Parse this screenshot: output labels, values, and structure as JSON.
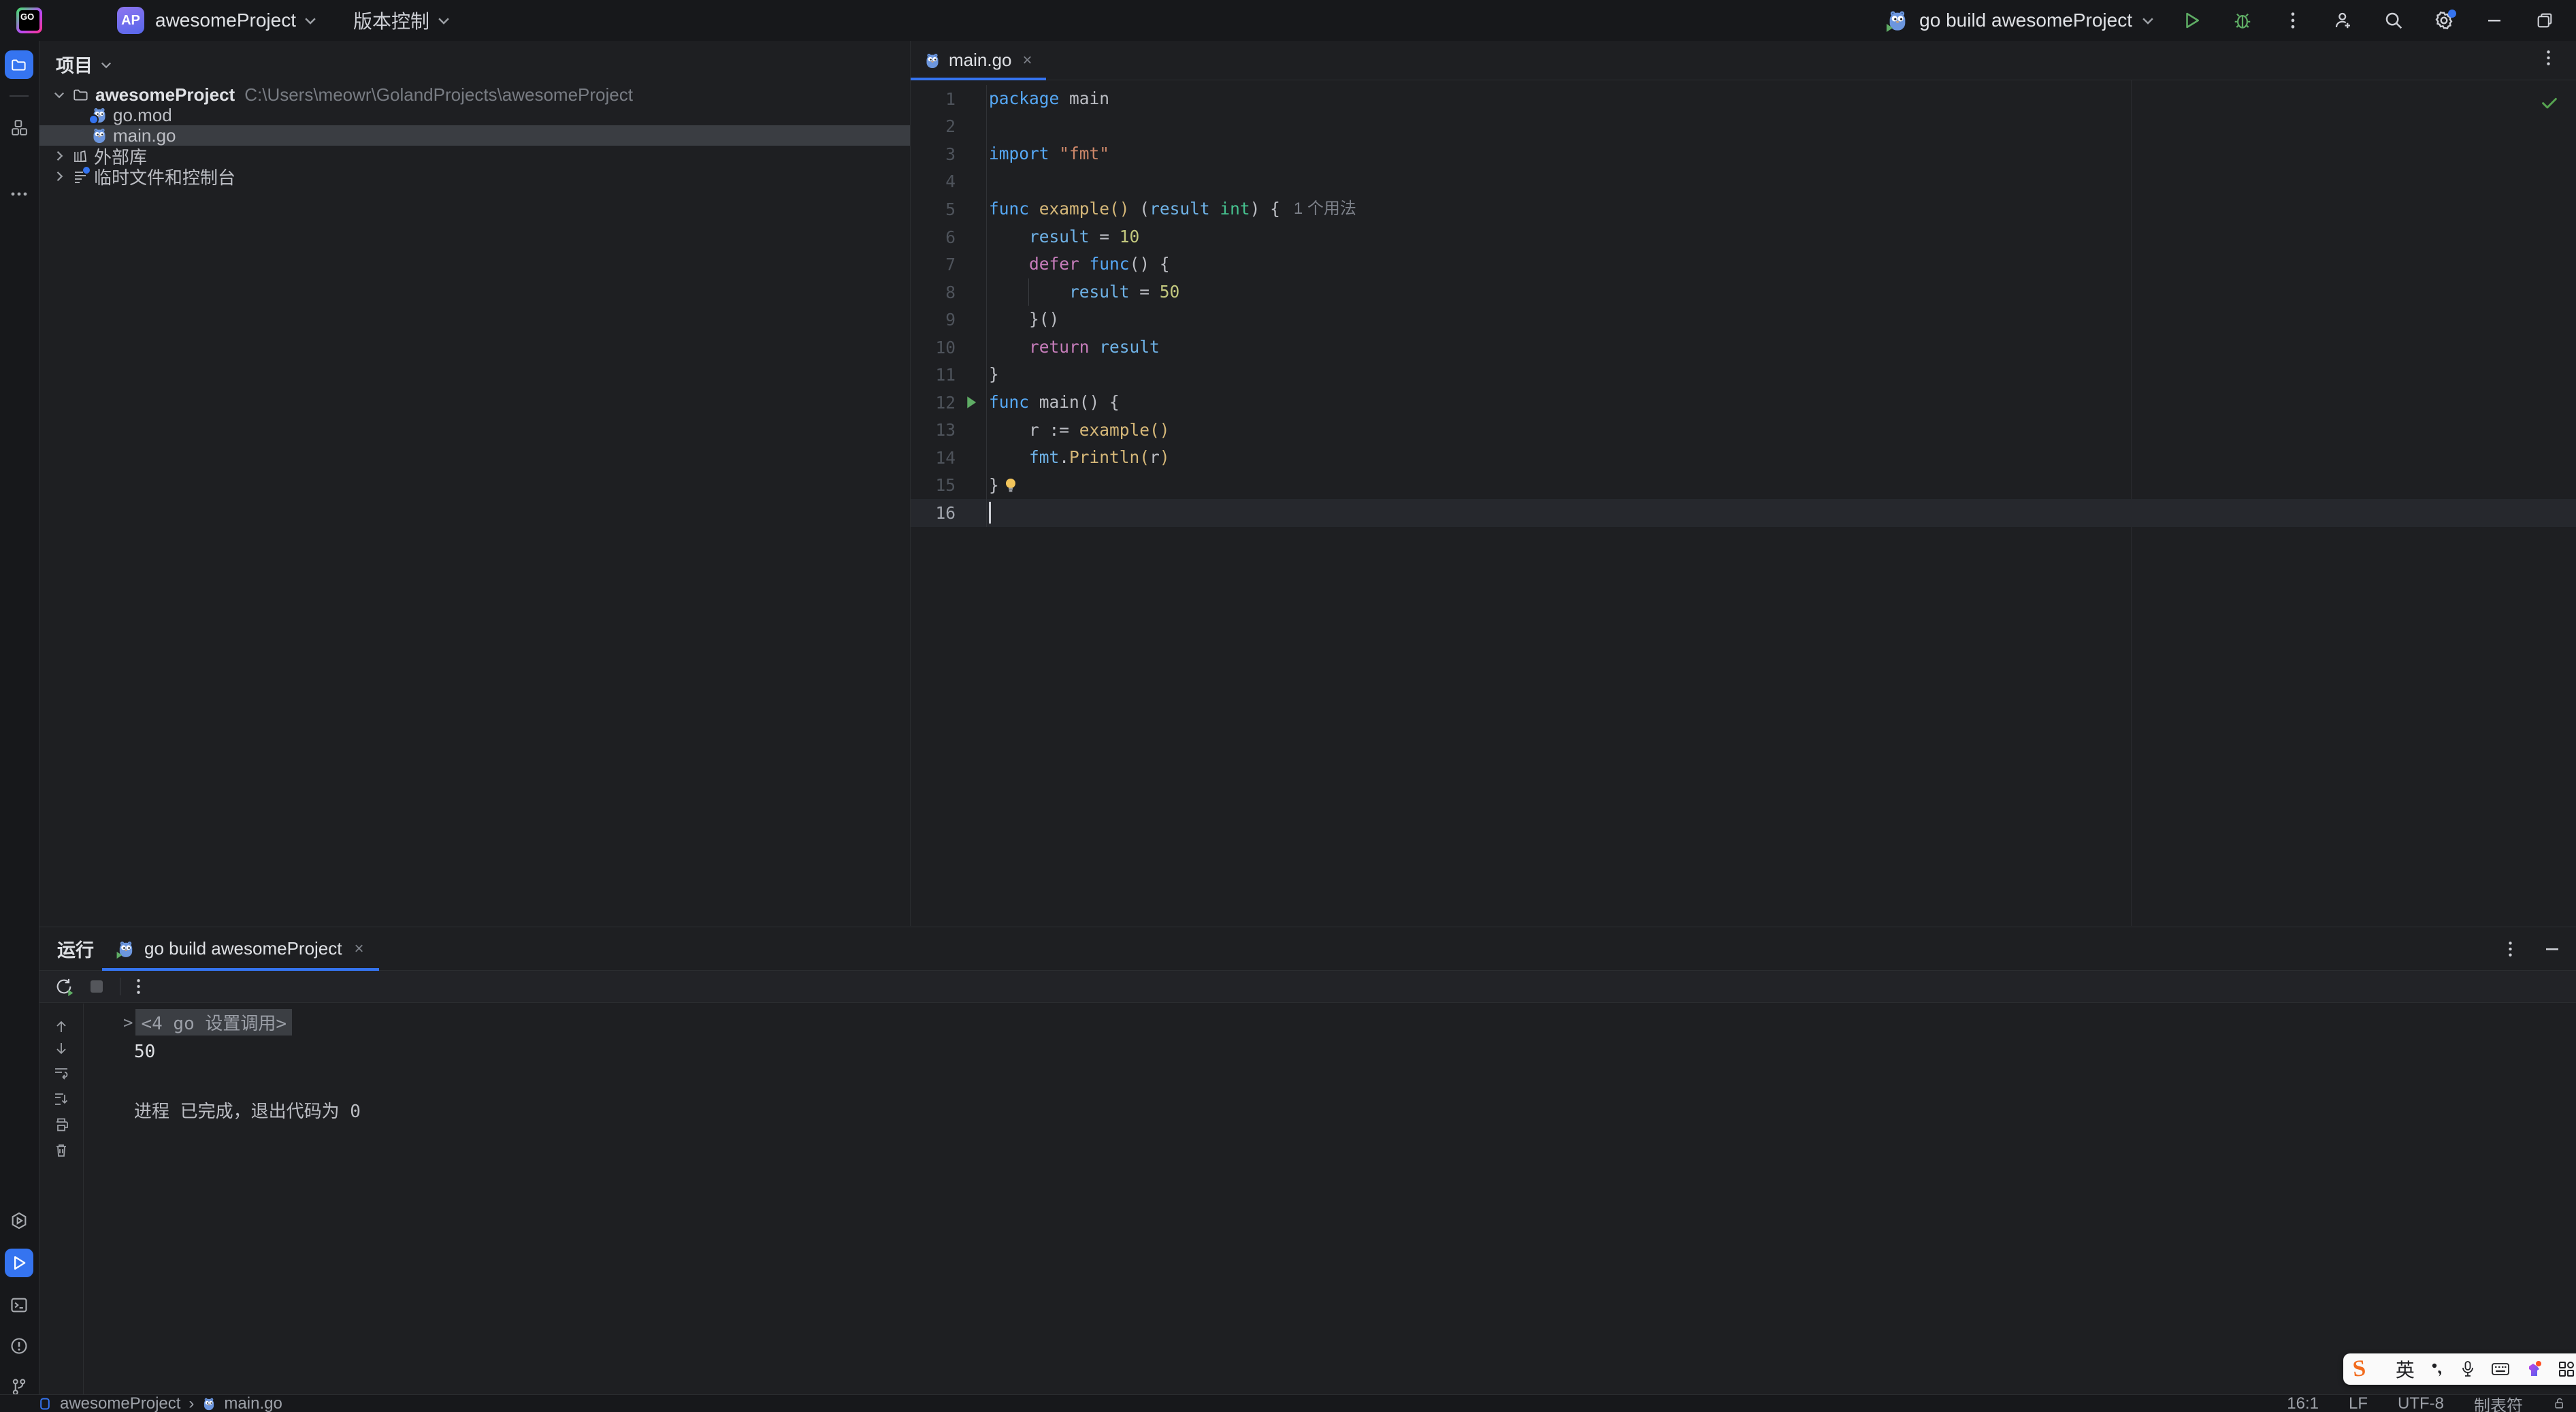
{
  "colors": {
    "accent": "#3574F0",
    "run_green": "#5FAD65",
    "check_green": "#57A551",
    "bg": "#1E1F22",
    "bg_dark": "#17181B",
    "selection": "#3A3D42"
  },
  "titlebar": {
    "logo": "GO",
    "menu_icon": "hamburger-icon",
    "project_avatar": "AP",
    "project_name": "awesomeProject",
    "vcs_menu": "版本控制",
    "run_config": "go build awesomeProject",
    "icons": [
      "run-icon",
      "debug-icon",
      "more-icon",
      "add-user-icon",
      "search-icon",
      "settings-icon",
      "minimize-icon",
      "restore-icon"
    ]
  },
  "stripe": {
    "top": [
      "project-folder-icon",
      "structure-icon",
      "more-icon"
    ],
    "bottom": [
      "services-icon",
      "run-icon",
      "terminal-icon",
      "problems-icon",
      "git-icon"
    ]
  },
  "project": {
    "header": "项目",
    "tree": [
      {
        "label": "awesomeProject",
        "path": "C:\\Users\\meowr\\GolandProjects\\awesomeProject",
        "icon": "folder-icon",
        "expanded": true
      },
      {
        "label": "go.mod",
        "icon": "go-module-icon"
      },
      {
        "label": "main.go",
        "icon": "go-file-icon",
        "selected": true
      },
      {
        "label": "外部库",
        "icon": "library-icon",
        "collapsed": true
      },
      {
        "label": "临时文件和控制台",
        "icon": "scratch-icon",
        "collapsed": true
      }
    ]
  },
  "editor": {
    "tab": {
      "label": "main.go",
      "icon": "go-file-icon",
      "close": "×"
    },
    "inlay_hint": "1 个用法",
    "lines": [
      {
        "num": "1",
        "tokens": [
          [
            "kw",
            "package"
          ],
          [
            "plain",
            " main"
          ]
        ]
      },
      {
        "num": "2",
        "tokens": []
      },
      {
        "num": "3",
        "tokens": [
          [
            "kw",
            "import"
          ],
          [
            "plain",
            " "
          ],
          [
            "str",
            "\"fmt\""
          ]
        ]
      },
      {
        "num": "4",
        "tokens": []
      },
      {
        "num": "5",
        "tokens": [
          [
            "kw",
            "func"
          ],
          [
            "plain",
            " "
          ],
          [
            "fn",
            "example()"
          ],
          [
            "plain",
            " ("
          ],
          [
            "param",
            "result"
          ],
          [
            "plain",
            " "
          ],
          [
            "type",
            "int"
          ],
          [
            "plain",
            ") {"
          ],
          [
            "inlay",
            "1 个用法"
          ]
        ]
      },
      {
        "num": "6",
        "tokens": [
          [
            "plain",
            "    "
          ],
          [
            "param",
            "result"
          ],
          [
            "plain",
            " = "
          ],
          [
            "num",
            "10"
          ]
        ]
      },
      {
        "num": "7",
        "tokens": [
          [
            "plain",
            "    "
          ],
          [
            "kw2",
            "defer"
          ],
          [
            "plain",
            " "
          ],
          [
            "kw",
            "func"
          ],
          [
            "plain",
            "() {"
          ]
        ]
      },
      {
        "num": "8",
        "tokens": [
          [
            "plain",
            "        "
          ],
          [
            "param",
            "result"
          ],
          [
            "plain",
            " = "
          ],
          [
            "num",
            "50"
          ]
        ],
        "guide": true
      },
      {
        "num": "9",
        "tokens": [
          [
            "plain",
            "    }()"
          ]
        ]
      },
      {
        "num": "10",
        "tokens": [
          [
            "plain",
            "    "
          ],
          [
            "kw2",
            "return"
          ],
          [
            "plain",
            " "
          ],
          [
            "param",
            "result"
          ]
        ]
      },
      {
        "num": "11",
        "tokens": [
          [
            "plain",
            "}"
          ]
        ]
      },
      {
        "num": "12",
        "tokens": [
          [
            "kw",
            "func"
          ],
          [
            "plain",
            " main() {"
          ]
        ],
        "run": true
      },
      {
        "num": "13",
        "tokens": [
          [
            "plain",
            "    r := "
          ],
          [
            "fn",
            "example()"
          ]
        ]
      },
      {
        "num": "14",
        "tokens": [
          [
            "plain",
            "    "
          ],
          [
            "param",
            "fmt"
          ],
          [
            "plain",
            "."
          ],
          [
            "fn",
            "Println("
          ],
          [
            "plain",
            "r"
          ],
          [
            "fn",
            ")"
          ]
        ]
      },
      {
        "num": "15",
        "tokens": [
          [
            "plain",
            "}"
          ]
        ],
        "bulb": true
      },
      {
        "num": "16",
        "tokens": [],
        "caret": true,
        "current": true
      }
    ]
  },
  "runpanel": {
    "title": "运行",
    "tab": {
      "label": "go build awesomeProject",
      "icon": "go-run-icon",
      "close": "×"
    },
    "toolbar": [
      "rerun-icon",
      "stop-icon",
      "more-icon"
    ],
    "gutter": [
      "up-icon",
      "down-icon",
      "soft-wrap-icon",
      "scroll-end-icon",
      "print-icon",
      "clear-icon"
    ],
    "console": {
      "folded_chevron": ">",
      "folded": "<4 go 设置调用>",
      "output": "50",
      "process": "进程 已完成，退出代码为 0"
    }
  },
  "statusbar": {
    "breadcrumb_project": "awesomeProject",
    "breadcrumb_sep": "›",
    "breadcrumb_file": "main.go",
    "caret_pos": "16:1",
    "line_ending": "LF",
    "encoding": "UTF-8",
    "indent": "制表符",
    "lock": "unlocked-icon"
  },
  "ime": {
    "logo": "S",
    "lang": "英",
    "icons": [
      "punctuation-icon",
      "mic-icon",
      "keyboard-icon",
      "skin-icon",
      "toolbox-icon",
      "emoji-icon"
    ]
  }
}
